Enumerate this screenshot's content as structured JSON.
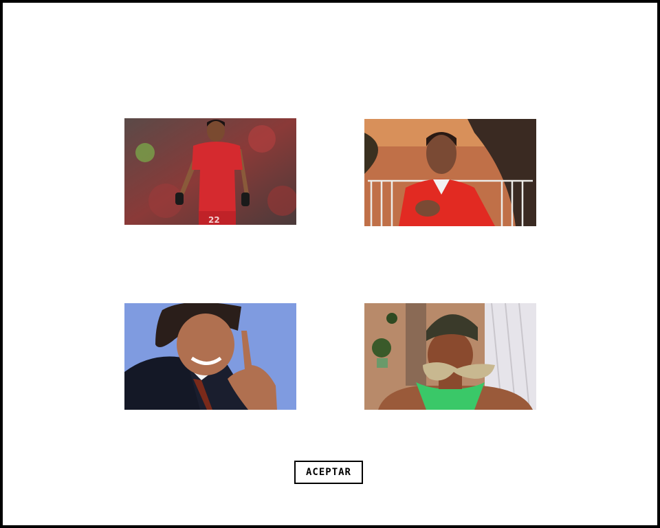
{
  "actions": {
    "accept_label": "ACEPTAR"
  },
  "photos": [
    {
      "id": "photo-1",
      "subject": "footballer-red-jersey"
    },
    {
      "id": "photo-2",
      "subject": "man-red-polo-hand-on-chest"
    },
    {
      "id": "photo-3",
      "subject": "smiling-man-dark-suit"
    },
    {
      "id": "photo-4",
      "subject": "young-man-sunglasses-green-tank"
    }
  ],
  "colors": {
    "border": "#000000",
    "background": "#ffffff",
    "button_text": "#000000"
  }
}
